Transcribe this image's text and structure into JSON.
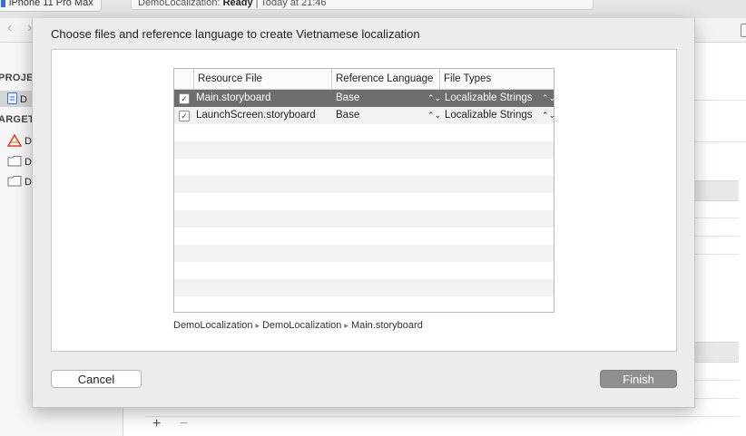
{
  "background": {
    "scheme": {
      "device": "iPhone 11 Pro Max"
    },
    "status": {
      "project": "DemoLocalization:",
      "state": "Ready",
      "timestamp": "| Today at 21:46"
    },
    "sidebar": {
      "project_header": "PROJEC",
      "targets_header": "ARGET",
      "items": [
        {
          "label": "D",
          "icon": "project-file-icon"
        },
        {
          "label": "D",
          "icon": "app-target-icon"
        },
        {
          "label": "D",
          "icon": "folder-icon"
        },
        {
          "label": "D",
          "icon": "folder-icon"
        }
      ]
    },
    "editor": {
      "add_label": "+",
      "remove_label": "−"
    }
  },
  "dialog": {
    "title": "Choose files and reference language to create Vietnamese localization",
    "table": {
      "columns": [
        "Resource File",
        "Reference Language",
        "File Types"
      ],
      "rows": [
        {
          "checked": true,
          "file": "Main.storyboard",
          "language": "Base",
          "file_type": "Localizable Strings",
          "selected": true
        },
        {
          "checked": true,
          "file": "LaunchScreen.storyboard",
          "language": "Base",
          "file_type": "Localizable Strings",
          "selected": false
        }
      ]
    },
    "path": [
      "DemoLocalization",
      "DemoLocalization",
      "Main.storyboard"
    ],
    "path_separator": "▸",
    "buttons": {
      "cancel": "Cancel",
      "finish": "Finish"
    }
  },
  "colors": {
    "selection": "#6e6e6e",
    "finish_button": "#8f8f8f",
    "accent_icon": "#3b6fd6"
  }
}
